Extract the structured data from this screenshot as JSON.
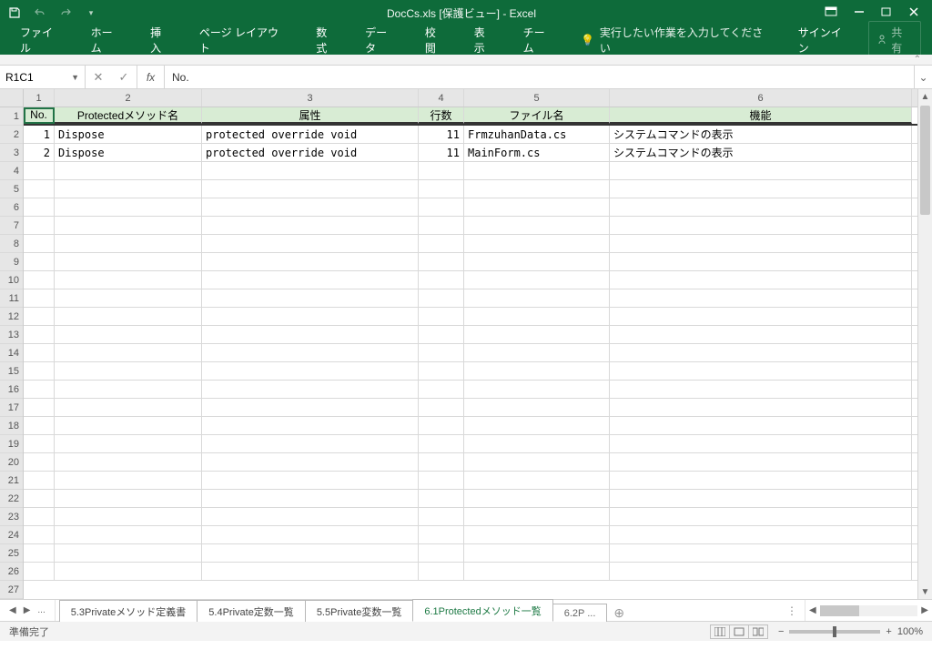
{
  "titlebar": {
    "title": "DocCs.xls  [保護ビュー] - Excel"
  },
  "ribbon": {
    "file": "ファイル",
    "tabs": [
      "ホーム",
      "挿入",
      "ページ レイアウト",
      "数式",
      "データ",
      "校閲",
      "表示",
      "チーム"
    ],
    "tellme": "実行したい作業を入力してください",
    "signin": "サインイン",
    "share": "共有"
  },
  "namebox": "R1C1",
  "formula": "No.",
  "col_headers": [
    "1",
    "2",
    "3",
    "4",
    "5",
    "6"
  ],
  "row_headers": [
    "1",
    "2",
    "3",
    "4",
    "5",
    "6",
    "7",
    "8",
    "9",
    "10",
    "11",
    "12",
    "13",
    "14",
    "15",
    "16",
    "17",
    "18",
    "19",
    "20",
    "21",
    "22",
    "23",
    "24",
    "25",
    "26",
    "27"
  ],
  "header_row": [
    "No.",
    "Protectedメソッド名",
    "属性",
    "行数",
    "ファイル名",
    "機能"
  ],
  "rows": [
    {
      "no": "1",
      "method": "Dispose",
      "attr": "protected override void",
      "lines": "11",
      "file": "FrmzuhanData.cs",
      "func": "システムコマンドの表示"
    },
    {
      "no": "2",
      "method": "Dispose",
      "attr": "protected override void",
      "lines": "11",
      "file": "MainForm.cs",
      "func": "システムコマンドの表示"
    }
  ],
  "sheet_tabs": {
    "more": "...",
    "items": [
      "5.3Privateメソッド定義書",
      "5.4Private定数一覧",
      "5.5Private変数一覧",
      "6.1Protectedメソッド一覧",
      "6.2P ..."
    ],
    "active_index": 3
  },
  "statusbar": {
    "ready": "準備完了",
    "zoom": "100%"
  }
}
